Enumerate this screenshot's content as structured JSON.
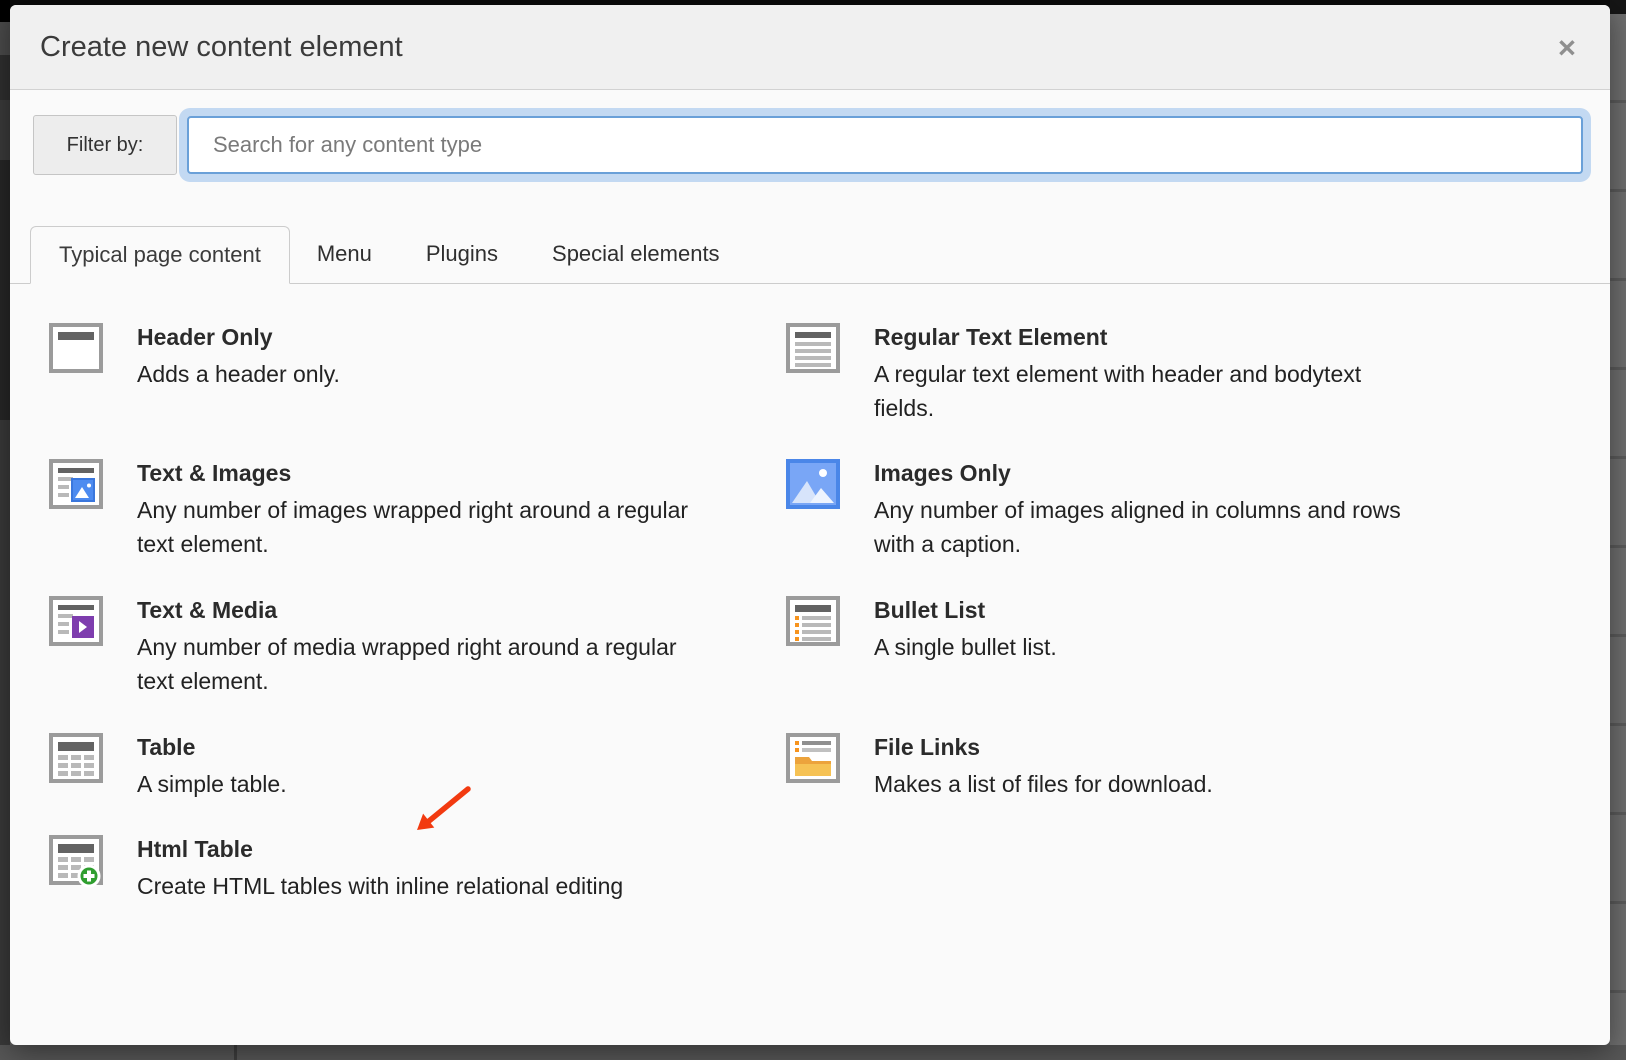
{
  "modal": {
    "title": "Create new content element",
    "close_glyph": "×"
  },
  "filter": {
    "label": "Filter by:",
    "placeholder": "Search for any content type",
    "value": "",
    "focus_ring_color": "#c3d9f2",
    "border_color": "#6aa0d8"
  },
  "tabs": [
    {
      "label": "Typical page content",
      "active": true
    },
    {
      "label": "Menu",
      "active": false
    },
    {
      "label": "Plugins",
      "active": false
    },
    {
      "label": "Special elements",
      "active": false
    }
  ],
  "content_elements": {
    "left_column": [
      {
        "icon": "header-only-icon",
        "title": "Header Only",
        "description": "Adds a header only."
      },
      {
        "icon": "text-images-icon",
        "title": "Text & Images",
        "description": "Any number of images wrapped right around a regular\ntext element."
      },
      {
        "icon": "text-media-icon",
        "title": "Text & Media",
        "description": "Any number of media wrapped right around a regular\ntext element."
      },
      {
        "icon": "table-icon",
        "title": "Table",
        "description": "A simple table."
      },
      {
        "icon": "html-table-icon",
        "title": "Html Table",
        "description": "Create HTML tables with inline relational editing"
      }
    ],
    "right_column": [
      {
        "icon": "regular-text-icon",
        "title": "Regular Text Element",
        "description": "A regular text element with header and bodytext\nfields."
      },
      {
        "icon": "images-only-icon",
        "title": "Images Only",
        "description": "Any number of images aligned in columns and rows\nwith a caption."
      },
      {
        "icon": "bullet-list-icon",
        "title": "Bullet List",
        "description": "A single bullet list."
      },
      {
        "icon": "file-links-icon",
        "title": "File Links",
        "description": "Makes a list of files for download."
      }
    ]
  },
  "annotation": {
    "type": "red-arrow",
    "color": "#f23a10",
    "points_to": "Html Table"
  },
  "accent_colors": {
    "orange": "#f7941e",
    "blue": "#4a86e8",
    "purple": "#7e3dae",
    "green": "#2f9e2f",
    "folder_yellow": "#f6c254"
  }
}
